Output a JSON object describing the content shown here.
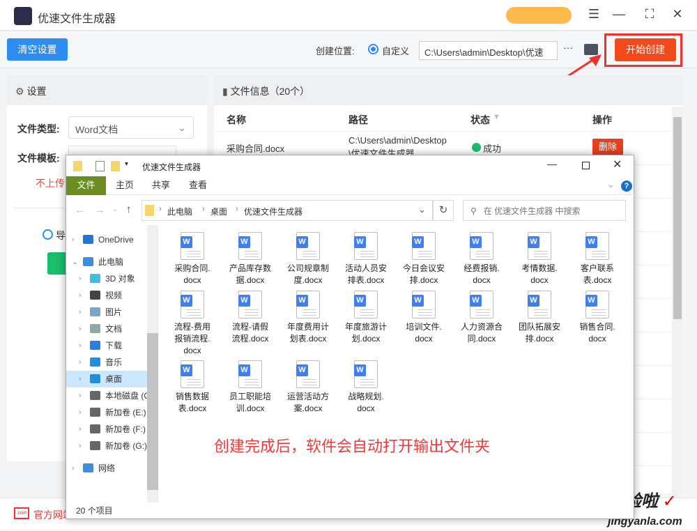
{
  "app": {
    "title": "优速文件生成器"
  },
  "window_controls": {
    "menu": "☰",
    "minimize": "—",
    "maximize": "⛶",
    "close": "✕"
  },
  "toolbar": {
    "clear_label": "清空设置",
    "location_label": "创建位置:",
    "radio_label": "自定义",
    "path_value": "C:\\Users\\admin\\Desktop\\优速",
    "more": "···",
    "start_label": "开始创建"
  },
  "settings": {
    "header": "设置",
    "file_type_label": "文件类型:",
    "file_type_value": "Word文档",
    "template_label": "文件模板:",
    "warning": "不上传",
    "radio_partial": "导"
  },
  "file_info": {
    "header": "文件信息（20个）",
    "columns": [
      "名称",
      "路径",
      "状态",
      "操作"
    ],
    "rows": [
      {
        "name": "采购合同.docx",
        "path": "C:\\Users\\admin\\Desktop\\优速文件生成器",
        "status": "成功",
        "action": "删除"
      }
    ]
  },
  "footer": {
    "link": "官方网站"
  },
  "explorer": {
    "title": "优速文件生成器",
    "tabs": [
      "文件",
      "主页",
      "共享",
      "查看"
    ],
    "breadcrumb": [
      "此电脑",
      "桌面",
      "优速文件生成器"
    ],
    "search_placeholder": "在 优速文件生成器 中搜索",
    "nav": [
      {
        "label": "OneDrive",
        "level": 0,
        "icon": "cloud-icon",
        "color": "#1e78d4"
      },
      {
        "label": "此电脑",
        "level": 0,
        "icon": "computer-icon",
        "color": "#3a8fe0",
        "expanded": true
      },
      {
        "label": "3D 对象",
        "level": 1,
        "icon": "cube-icon",
        "color": "#3cc0e0"
      },
      {
        "label": "视频",
        "level": 1,
        "icon": "film-icon",
        "color": "#444"
      },
      {
        "label": "图片",
        "level": 1,
        "icon": "picture-icon",
        "color": "#7aa7c7"
      },
      {
        "label": "文档",
        "level": 1,
        "icon": "document-icon",
        "color": "#8aa"
      },
      {
        "label": "下载",
        "level": 1,
        "icon": "download-icon",
        "color": "#2a7de1"
      },
      {
        "label": "音乐",
        "level": 1,
        "icon": "music-icon",
        "color": "#1e90e0"
      },
      {
        "label": "桌面",
        "level": 1,
        "icon": "desktop-icon",
        "color": "#1e90e0",
        "selected": true
      },
      {
        "label": "本地磁盘 (C:)",
        "level": 1,
        "icon": "drive-icon",
        "color": "#666"
      },
      {
        "label": "新加卷 (E:)",
        "level": 1,
        "icon": "drive-icon",
        "color": "#666"
      },
      {
        "label": "新加卷 (F:)",
        "level": 1,
        "icon": "drive-icon",
        "color": "#666"
      },
      {
        "label": "新加卷 (G:)",
        "level": 1,
        "icon": "drive-icon",
        "color": "#666"
      },
      {
        "label": "网络",
        "level": 0,
        "icon": "network-icon",
        "color": "#3a8fe0"
      }
    ],
    "files": [
      [
        "采购合同.",
        "docx"
      ],
      [
        "产品库存数",
        "据.docx"
      ],
      [
        "公司规章制",
        "度.docx"
      ],
      [
        "活动人员安",
        "排表.docx"
      ],
      [
        "今日会议安",
        "排.docx"
      ],
      [
        "经费报销.",
        "docx"
      ],
      [
        "考情数据.",
        "docx"
      ],
      [
        "客户联系",
        "表.docx"
      ],
      [
        "流程-费用",
        "报销流程.",
        "docx"
      ],
      [
        "流程-请假",
        "流程.docx"
      ],
      [
        "年度费用计",
        "划表.docx"
      ],
      [
        "年度旅游计",
        "划.docx"
      ],
      [
        "培训文件.",
        "docx"
      ],
      [
        "人力资源合",
        "同.docx"
      ],
      [
        "团队拓展安",
        "排.docx"
      ],
      [
        "销售合同.",
        "docx"
      ],
      [
        "销售数据",
        "表.docx"
      ],
      [
        "员工职能培",
        "训.docx"
      ],
      [
        "运营活动方",
        "案.docx"
      ],
      [
        "战略规划.",
        "docx"
      ]
    ],
    "status": "20 个项目",
    "annotation": "创建完成后，软件会自动打开输出文件夹"
  },
  "watermark": "经验啦 jingyanla.com",
  "colors": {
    "primary": "#2d8cf0",
    "danger": "#f24a1d",
    "success": "#19be6b",
    "ribbon_file": "#6b8e23",
    "annotation": "#f03a3a"
  }
}
